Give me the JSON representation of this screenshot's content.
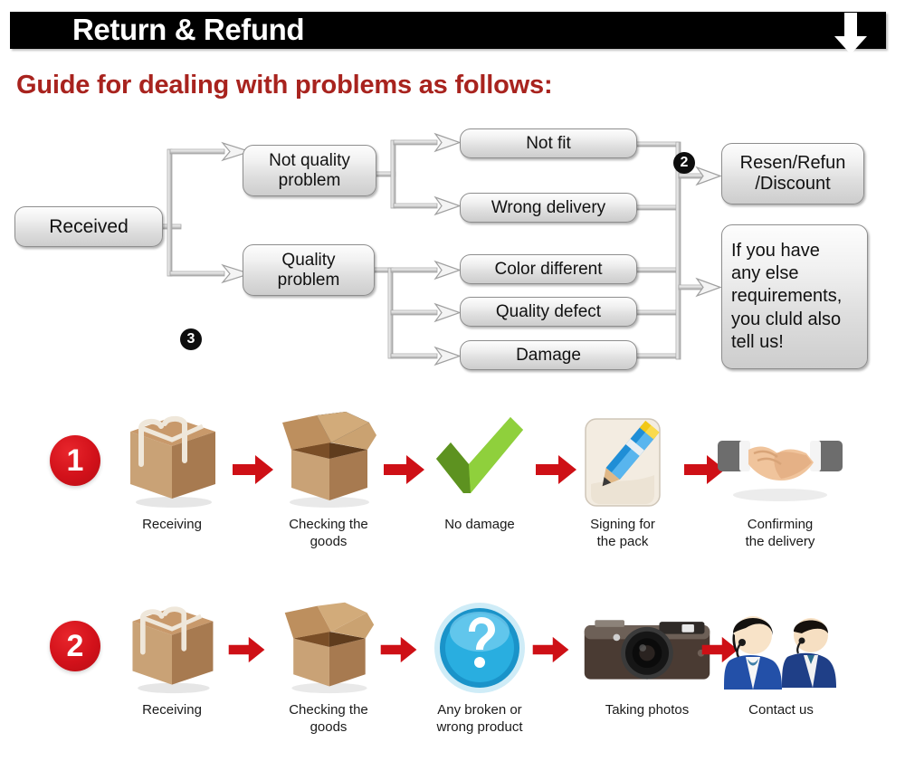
{
  "header": {
    "title": "Return & Refund",
    "arrow_icon": "down-arrow-icon",
    "bar_color": "#000000",
    "text_color": "#ffffff"
  },
  "guide": {
    "heading": "Guide for dealing with problems as follows:",
    "color": "#A8231E"
  },
  "flowchart": {
    "start": {
      "label": "Received"
    },
    "badge_3": "3",
    "badge_2": "2",
    "branches": [
      {
        "label": "Not quality\nproblem",
        "line1": "Not quality",
        "line2": "problem"
      },
      {
        "label": "Quality\nproblem",
        "line1": "Quality",
        "line2": "problem"
      }
    ],
    "non_quality_issues": [
      {
        "label": "Not fit"
      },
      {
        "label": "Wrong delivery"
      }
    ],
    "quality_issues": [
      {
        "label": "Color different"
      },
      {
        "label": "Quality defect"
      },
      {
        "label": "Damage"
      }
    ],
    "outcomes": [
      {
        "line1": "Resen/Refun",
        "line2": "/Discount"
      },
      {
        "lines": [
          "If you have",
          "any else",
          "requirements,",
          "you cluld also",
          "tell us!"
        ]
      }
    ]
  },
  "steps": {
    "row1": {
      "number": "1",
      "items": [
        {
          "icon": "closed-box-icon",
          "label": "Receiving"
        },
        {
          "icon": "open-box-icon",
          "label": "Checking the\ngoods",
          "line1": "Checking the",
          "line2": "goods"
        },
        {
          "icon": "green-check-icon",
          "label": "No damage"
        },
        {
          "icon": "pencil-signing-icon",
          "label": "Signing for\nthe pack",
          "line1": "Signing for",
          "line2": "the pack"
        },
        {
          "icon": "handshake-icon",
          "label": "Confirming\nthe delivery",
          "line1": "Confirming",
          "line2": "the delivery"
        }
      ]
    },
    "row2": {
      "number": "2",
      "items": [
        {
          "icon": "closed-box-icon",
          "label": "Receiving"
        },
        {
          "icon": "open-box-icon",
          "label": "Checking the\ngoods",
          "line1": "Checking the",
          "line2": "goods"
        },
        {
          "icon": "question-mark-icon",
          "label": "Any broken or\nwrong product",
          "line1": "Any broken or",
          "line2": "wrong product"
        },
        {
          "icon": "camera-icon",
          "label": "Taking photos"
        },
        {
          "icon": "support-agents-icon",
          "label": "Contact us"
        }
      ]
    },
    "arrow_icon": "red-right-arrow-icon",
    "arrow_color": "#CE1016",
    "badge_color": "#D2111A"
  }
}
